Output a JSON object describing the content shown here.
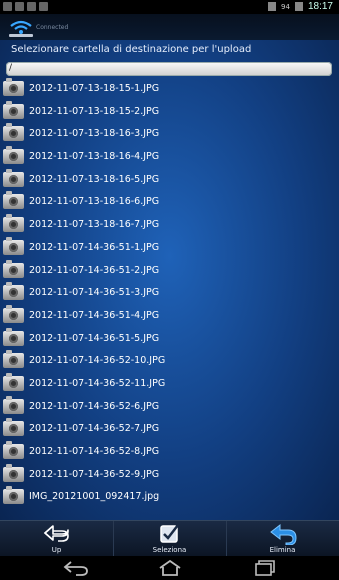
{
  "status_bar": {
    "battery": "94",
    "time": "18:17"
  },
  "header": {
    "connection_status": "Connected"
  },
  "main": {
    "destination_label": "Selezionare cartella di destinazione per l'upload",
    "path_value": "/",
    "files": [
      "2012-11-07-13-18-15-1.JPG",
      "2012-11-07-13-18-15-2.JPG",
      "2012-11-07-13-18-16-3.JPG",
      "2012-11-07-13-18-16-4.JPG",
      "2012-11-07-13-18-16-5.JPG",
      "2012-11-07-13-18-16-6.JPG",
      "2012-11-07-13-18-16-7.JPG",
      "2012-11-07-14-36-51-1.JPG",
      "2012-11-07-14-36-51-2.JPG",
      "2012-11-07-14-36-51-3.JPG",
      "2012-11-07-14-36-51-4.JPG",
      "2012-11-07-14-36-51-5.JPG",
      "2012-11-07-14-36-52-10.JPG",
      "2012-11-07-14-36-52-11.JPG",
      "2012-11-07-14-36-52-6.JPG",
      "2012-11-07-14-36-52-7.JPG",
      "2012-11-07-14-36-52-8.JPG",
      "2012-11-07-14-36-52-9.JPG",
      "IMG_20121001_092417.jpg"
    ]
  },
  "toolbar": {
    "up_label": "Up",
    "select_label": "Seleziona",
    "delete_label": "Elimina"
  }
}
